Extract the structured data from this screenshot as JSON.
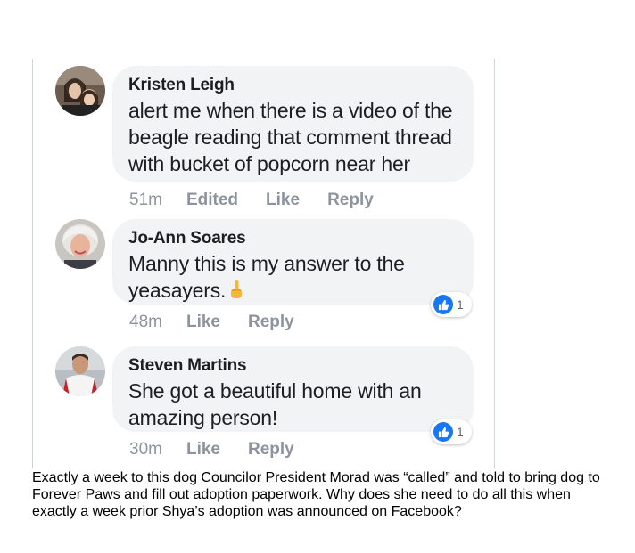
{
  "comments": [
    {
      "author": "Kristen Leigh",
      "lines": [
        "alert me when there is a video of the",
        "beagle reading that comment thread",
        "with bucket of popcorn near her"
      ],
      "time": "51m",
      "edited": "Edited",
      "like": "Like",
      "reply": "Reply"
    },
    {
      "author": "Jo-Ann Soares",
      "lines": [
        "Manny this is my answer to the",
        "yeasayers."
      ],
      "emoji": "middle-finger-emoji",
      "time": "48m",
      "like": "Like",
      "reply": "Reply",
      "reaction_count": "1",
      "reaction_icon": "thumbs-up-icon"
    },
    {
      "author": "Steven Martins",
      "lines": [
        "She got a beautiful home with an",
        "amazing person!"
      ],
      "time": "30m",
      "like": "Like",
      "reply": "Reply",
      "reaction_count": "1",
      "reaction_icon": "thumbs-up-icon"
    }
  ],
  "caption": "Exactly a week to this dog Councilor President Morad was “called” and told to bring dog to Forever Paws and fill out adoption paperwork. Why does she need to do all this when exactly a week prior Shya’s adoption was announced on Facebook?",
  "colors": {
    "bubble": "#f2f3f5",
    "meta_text": "#8d949e",
    "like_blue": "#1877f2"
  }
}
